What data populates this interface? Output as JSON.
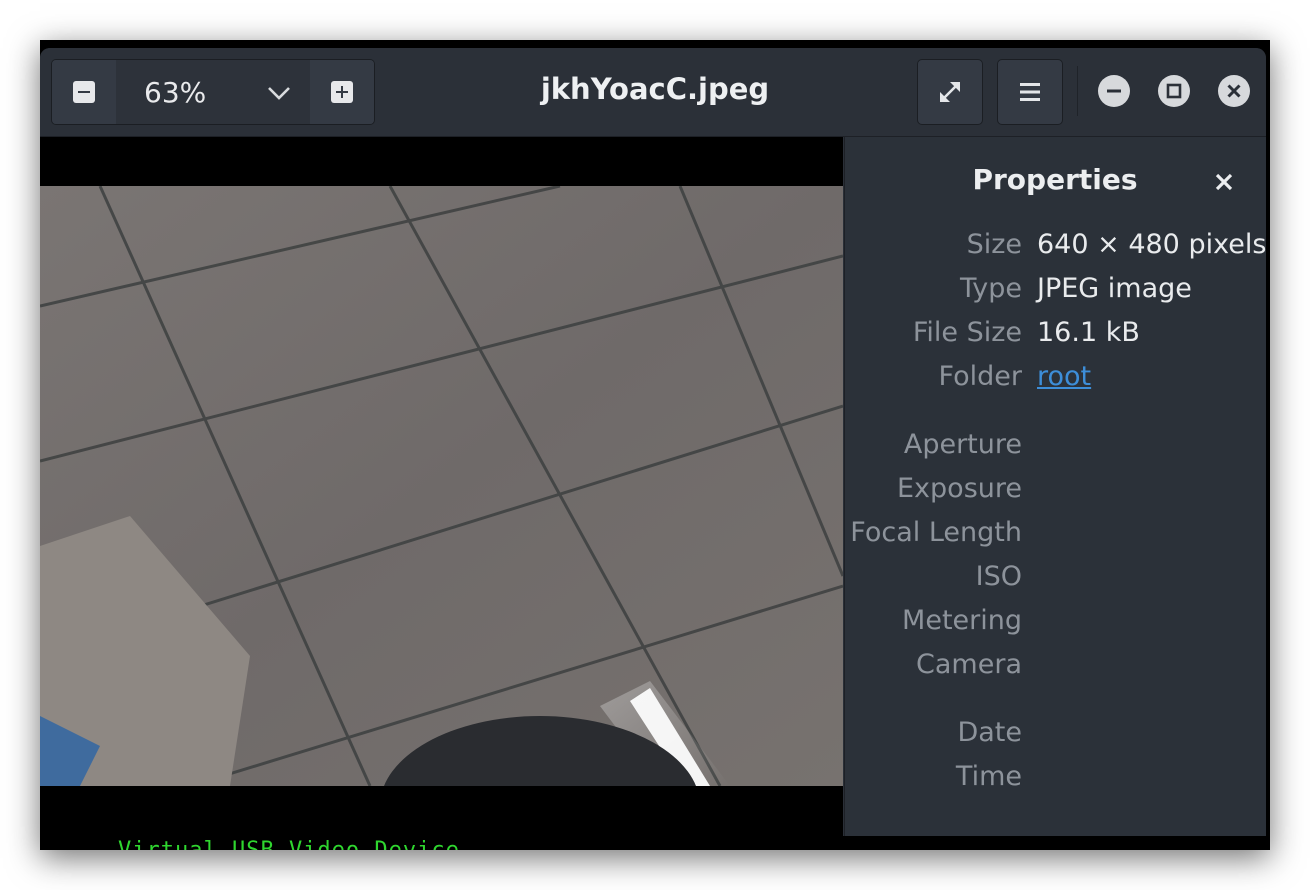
{
  "window": {
    "title": "jkhYoacC.jpeg"
  },
  "toolbar": {
    "zoom_value": "63%"
  },
  "terminal": {
    "text": "Virtual USB Video Device"
  },
  "properties": {
    "title": "Properties",
    "rows": [
      {
        "label": "Size",
        "value": "640 × 480 pixels"
      },
      {
        "label": "Type",
        "value": "JPEG image"
      },
      {
        "label": "File Size",
        "value": "16.1 kB"
      },
      {
        "label": "Folder",
        "value": "root"
      },
      {
        "label": "Aperture",
        "value": ""
      },
      {
        "label": "Exposure",
        "value": ""
      },
      {
        "label": "Focal Length",
        "value": ""
      },
      {
        "label": "ISO",
        "value": ""
      },
      {
        "label": "Metering",
        "value": ""
      },
      {
        "label": "Camera",
        "value": ""
      },
      {
        "label": "Date",
        "value": ""
      },
      {
        "label": "Time",
        "value": ""
      }
    ]
  },
  "colors": {
    "headerbar": "#2b3038",
    "sidebar": "#2b3139",
    "link": "#3d8ed9",
    "terminal_text": "#2fd62f"
  }
}
